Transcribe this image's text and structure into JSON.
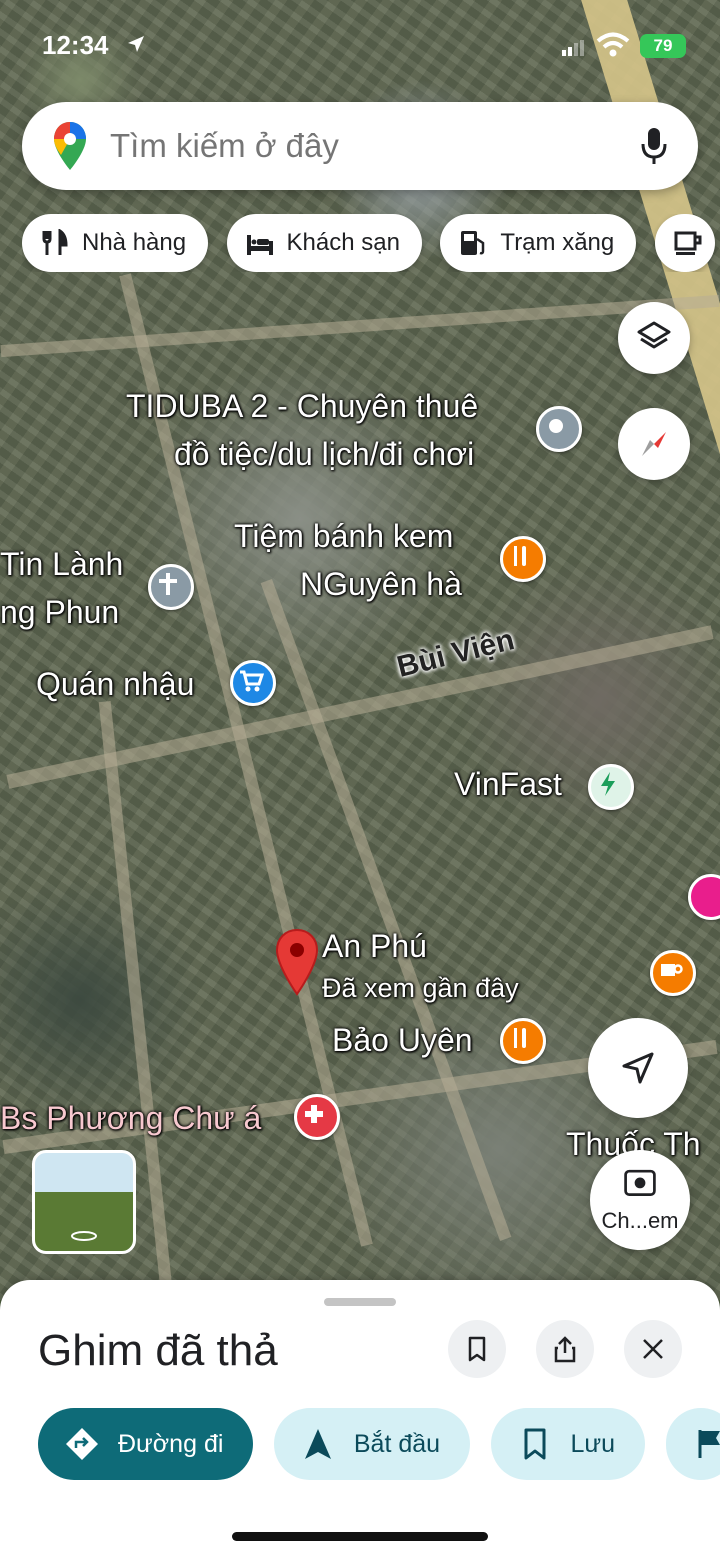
{
  "status_bar": {
    "time": "12:34",
    "battery": "79"
  },
  "search": {
    "placeholder": "Tìm kiếm ở đây"
  },
  "chips": [
    {
      "label": "Nhà hàng",
      "icon": "fork-knife-icon"
    },
    {
      "label": "Khách sạn",
      "icon": "bed-icon"
    },
    {
      "label": "Trạm xăng",
      "icon": "gas-station-icon"
    },
    {
      "label": "",
      "icon": "coffee-icon"
    }
  ],
  "map": {
    "labels": {
      "tiduba_line1": "TIDUBA 2 - Chuyên thuê",
      "tiduba_line2": "đồ tiệc/du lịch/đi chơi",
      "tin_lanh_line1": "Tin Lành",
      "tin_lanh_line2": "ng Phun",
      "bakery_line1": "Tiệm bánh kem",
      "bakery_line2": "NGuyên hà",
      "bui_vien": "Bùi Viện",
      "quan_nhau": "Quán nhậu",
      "vinfast": "VinFast",
      "an_phu": "An Phú",
      "recently_viewed": "Đã xem gần đây",
      "bao_uyen": "Bảo Uyên",
      "bs_phuong": "Bs Phương Chư á",
      "thuoc_line1": "Thuốc Th",
      "camera_label": "Ch...em"
    }
  },
  "sheet": {
    "title": "Ghim đã thả",
    "actions": [
      {
        "label": "Đường đi",
        "icon": "directions-icon"
      },
      {
        "label": "Bắt đầu",
        "icon": "navigation-arrow-icon"
      },
      {
        "label": "Lưu",
        "icon": "bookmark-icon"
      },
      {
        "label": "",
        "icon": "flag-icon"
      }
    ]
  },
  "colors": {
    "primary_action": "#0e6b78",
    "secondary_action": "#d5f0f5",
    "pin": "#e53935"
  }
}
